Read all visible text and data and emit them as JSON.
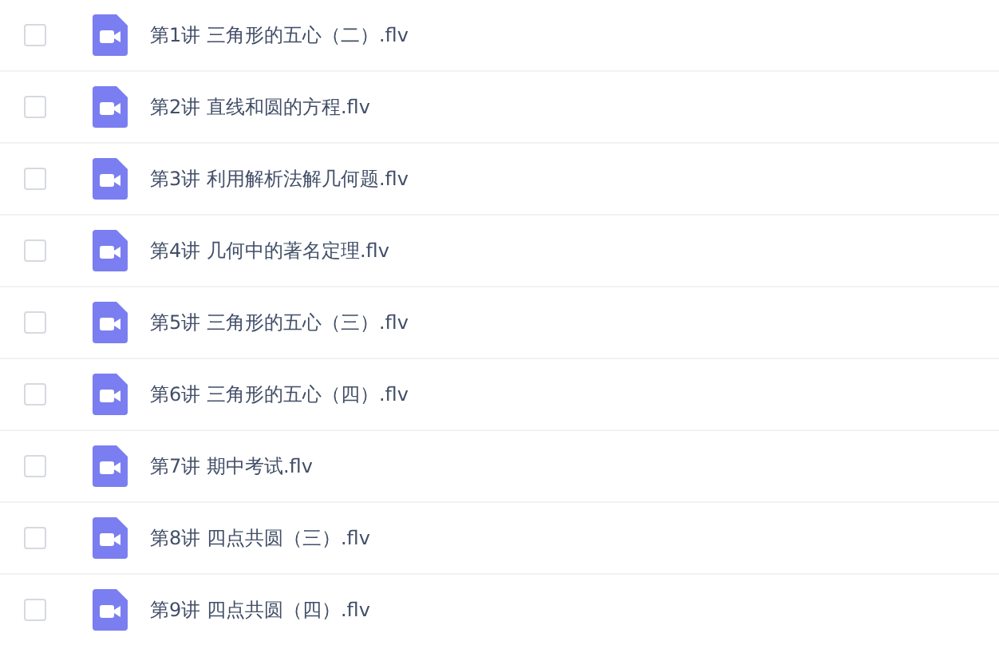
{
  "files": [
    {
      "name": "第1讲 三角形的五心（二）.flv",
      "checked": false
    },
    {
      "name": "第2讲 直线和圆的方程.flv",
      "checked": false
    },
    {
      "name": "第3讲 利用解析法解几何题.flv",
      "checked": false
    },
    {
      "name": "第4讲 几何中的著名定理.flv",
      "checked": false
    },
    {
      "name": "第5讲 三角形的五心（三）.flv",
      "checked": false
    },
    {
      "name": "第6讲 三角形的五心（四）.flv",
      "checked": false
    },
    {
      "name": "第7讲 期中考试.flv",
      "checked": false
    },
    {
      "name": "第8讲 四点共圆（三）.flv",
      "checked": false
    },
    {
      "name": "第9讲 四点共圆（四）.flv",
      "checked": false
    }
  ]
}
